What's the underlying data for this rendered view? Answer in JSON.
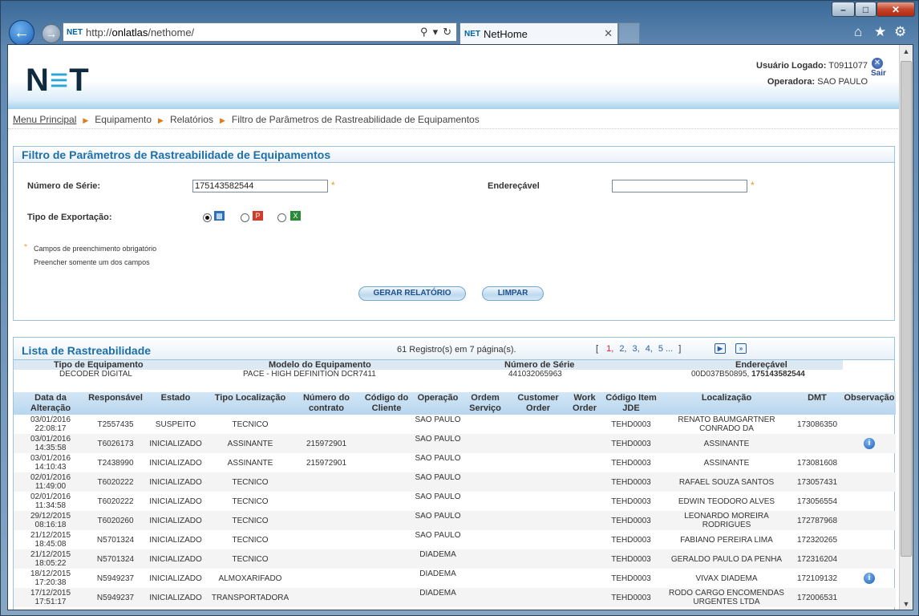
{
  "browser": {
    "url_prefix": "http://",
    "url_host": "onlatlas",
    "url_path": "/nethome/",
    "address_logo": "NET",
    "tab_logo": "NET",
    "tab_title": "NetHome"
  },
  "header": {
    "logo": "NET",
    "user_label": "Usuário Logado:",
    "user_value": "T0911077",
    "operator_label": "Operadora:",
    "operator_value": "SAO PAULO",
    "logout_label": "Sair"
  },
  "breadcrumb": [
    "Menu Principal",
    "Equipamento",
    "Relatórios",
    "Filtro de Parâmetros de Rastreabilidade de Equipamentos"
  ],
  "filter": {
    "title": "Filtro de Parâmetros de Rastreabilidade de Equipamentos",
    "serial_label": "Número de Série:",
    "serial_value": "175143582544",
    "addressable_label": "Endereçável",
    "addressable_value": "",
    "export_label": "Tipo de Exportação:",
    "required_mark": "*",
    "note_required": "Campos de preenchimento obrigatório",
    "note_single": "Preencher somente um dos campos",
    "generate_button": "GERAR RELATÓRIO",
    "clear_button": "LIMPAR"
  },
  "list": {
    "title": "Lista de Rastreabilidade",
    "records": "61 Registro(s) em 7 página(s).",
    "pages": [
      "1,",
      "2,",
      "3,",
      "4,",
      "5 ..."
    ],
    "pager_open": "[",
    "pager_close": "]",
    "equipment_headers": [
      "Tipo de Equipamento",
      "Modelo do Equipamento",
      "Número de Série",
      "Endereçável"
    ],
    "equipment": {
      "type": "DECODER DIGITAL",
      "model": "PACE - HIGH DEFINITION DCR7411",
      "serial": "441032065963",
      "addressable_a": "00D037B50895,",
      "addressable_b": "175143582544"
    },
    "columns": [
      "Data da Alteração",
      "Responsável",
      "Estado",
      "Tipo Localização",
      "Número do contrato",
      "Código do Cliente",
      "Operação",
      "Ordem Serviço",
      "Customer Order",
      "Work Order",
      "Código Item JDE",
      "Localização",
      "DMT",
      "Observação"
    ],
    "rows": [
      {
        "date": "03/01/2016 22:08:17",
        "resp": "T2557435",
        "state": "SUSPEITO",
        "tloc": "TECNICO",
        "contract": "",
        "client": "",
        "op": "SAO PAULO",
        "os": "",
        "co": "",
        "wo": "",
        "jde": "TEHD0003",
        "loc": "RENATO BAUMGARTNER CONRADO DA",
        "dmt": "173086350",
        "obs": false
      },
      {
        "date": "03/01/2016 14:35:58",
        "resp": "T6026173",
        "state": "INICIALIZADO",
        "tloc": "ASSINANTE",
        "contract": "215972901",
        "client": "",
        "op": "SAO PAULO",
        "os": "",
        "co": "",
        "wo": "",
        "jde": "TEHD0003",
        "loc": "ASSINANTE",
        "dmt": "",
        "obs": true
      },
      {
        "date": "03/01/2016 14:10:43",
        "resp": "T2438990",
        "state": "INICIALIZADO",
        "tloc": "ASSINANTE",
        "contract": "215972901",
        "client": "",
        "op": "SAO PAULO",
        "os": "",
        "co": "",
        "wo": "",
        "jde": "TEHD0003",
        "loc": "ASSINANTE",
        "dmt": "173081608",
        "obs": false
      },
      {
        "date": "02/01/2016 11:49:00",
        "resp": "T6020222",
        "state": "INICIALIZADO",
        "tloc": "TECNICO",
        "contract": "",
        "client": "",
        "op": "SAO PAULO",
        "os": "",
        "co": "",
        "wo": "",
        "jde": "TEHD0003",
        "loc": "RAFAEL SOUZA SANTOS",
        "dmt": "173057431",
        "obs": false
      },
      {
        "date": "02/01/2016 11:34:58",
        "resp": "T6020222",
        "state": "INICIALIZADO",
        "tloc": "TECNICO",
        "contract": "",
        "client": "",
        "op": "SAO PAULO",
        "os": "",
        "co": "",
        "wo": "",
        "jde": "TEHD0003",
        "loc": "EDWIN TEODORO ALVES",
        "dmt": "173056554",
        "obs": false
      },
      {
        "date": "29/12/2015 08:16:18",
        "resp": "T6020260",
        "state": "INICIALIZADO",
        "tloc": "TECNICO",
        "contract": "",
        "client": "",
        "op": "SAO PAULO",
        "os": "",
        "co": "",
        "wo": "",
        "jde": "TEHD0003",
        "loc": "LEONARDO MOREIRA RODRIGUES",
        "dmt": "172787968",
        "obs": false
      },
      {
        "date": "21/12/2015 18:45:08",
        "resp": "N5701324",
        "state": "INICIALIZADO",
        "tloc": "TECNICO",
        "contract": "",
        "client": "",
        "op": "SAO PAULO",
        "os": "",
        "co": "",
        "wo": "",
        "jde": "TEHD0003",
        "loc": "FABIANO PEREIRA LIMA",
        "dmt": "172320265",
        "obs": false
      },
      {
        "date": "21/12/2015 18:05:22",
        "resp": "N5701324",
        "state": "INICIALIZADO",
        "tloc": "TECNICO",
        "contract": "",
        "client": "",
        "op": "DIADEMA",
        "os": "",
        "co": "",
        "wo": "",
        "jde": "TEHD0003",
        "loc": "GERALDO PAULO DA PENHA",
        "dmt": "172316204",
        "obs": false
      },
      {
        "date": "18/12/2015 17:20:38",
        "resp": "N5949237",
        "state": "INICIALIZADO",
        "tloc": "ALMOXARIFADO",
        "contract": "",
        "client": "",
        "op": "DIADEMA",
        "os": "",
        "co": "",
        "wo": "",
        "jde": "TEHD0003",
        "loc": "VIVAX DIADEMA",
        "dmt": "172109132",
        "obs": true
      },
      {
        "date": "17/12/2015 17:51:17",
        "resp": "N5949237",
        "state": "INICIALIZADO",
        "tloc": "TRANSPORTADORA",
        "contract": "",
        "client": "",
        "op": "DIADEMA",
        "os": "",
        "co": "",
        "wo": "",
        "jde": "TEHD0003",
        "loc": "RODO CARGO ENCOMENDAS URGENTES LTDA",
        "dmt": "172006531",
        "obs": false
      }
    ]
  },
  "colors": {
    "accent": "#1e6fa8",
    "required": "#e89a1a",
    "header_bg": "#b8d6ee"
  }
}
